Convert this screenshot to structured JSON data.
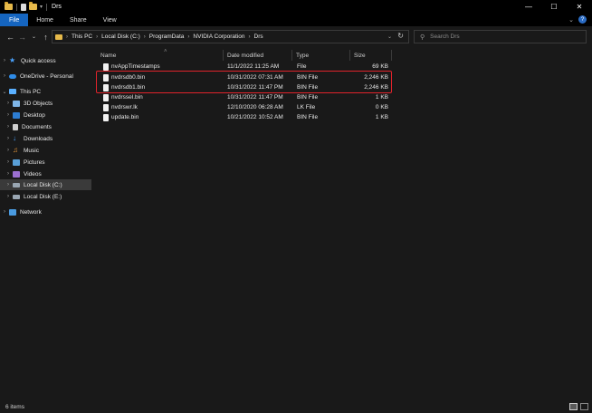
{
  "window": {
    "title": "Drs"
  },
  "ribbon": {
    "tabs": [
      "File",
      "Home",
      "Share",
      "View"
    ]
  },
  "address": {
    "crumbs": [
      "This PC",
      "Local Disk (C:)",
      "ProgramData",
      "NVIDIA Corporation",
      "Drs"
    ]
  },
  "search": {
    "placeholder": "Search Drs"
  },
  "nav": {
    "items": [
      {
        "label": "Quick access",
        "icon": "star-icon"
      },
      {
        "label": "OneDrive - Personal",
        "icon": "cloud-icon"
      },
      {
        "label": "This PC",
        "icon": "computer-icon"
      },
      {
        "label": "3D Objects",
        "icon": "cube-icon"
      },
      {
        "label": "Desktop",
        "icon": "desktop-icon"
      },
      {
        "label": "Documents",
        "icon": "document-icon"
      },
      {
        "label": "Downloads",
        "icon": "download-icon"
      },
      {
        "label": "Music",
        "icon": "music-icon"
      },
      {
        "label": "Pictures",
        "icon": "pictures-icon"
      },
      {
        "label": "Videos",
        "icon": "videos-icon"
      },
      {
        "label": "Local Disk (C:)",
        "icon": "disk-icon"
      },
      {
        "label": "Local Disk (E:)",
        "icon": "disk-icon"
      },
      {
        "label": "Network",
        "icon": "network-icon"
      }
    ]
  },
  "columns": {
    "name": "Name",
    "date": "Date modified",
    "type": "Type",
    "size": "Size"
  },
  "files": [
    {
      "name": "nvAppTimestamps",
      "date": "11/1/2022 11:25 AM",
      "type": "File",
      "size": "69 KB"
    },
    {
      "name": "nvdrsdb0.bin",
      "date": "10/31/2022 07:31 AM",
      "type": "BIN File",
      "size": "2,246 KB"
    },
    {
      "name": "nvdrsdb1.bin",
      "date": "10/31/2022 11:47 PM",
      "type": "BIN File",
      "size": "2,246 KB"
    },
    {
      "name": "nvdrssel.bin",
      "date": "10/31/2022 11:47 PM",
      "type": "BIN File",
      "size": "1 KB"
    },
    {
      "name": "nvdrswr.lk",
      "date": "12/10/2020 06:28 AM",
      "type": "LK File",
      "size": "0 KB"
    },
    {
      "name": "update.bin",
      "date": "10/21/2022 10:52 AM",
      "type": "BIN File",
      "size": "1 KB"
    }
  ],
  "status": {
    "count": "6 items"
  },
  "colors": {
    "accent": "#1565c0",
    "highlight": "#e0232b",
    "background": "#191919"
  }
}
